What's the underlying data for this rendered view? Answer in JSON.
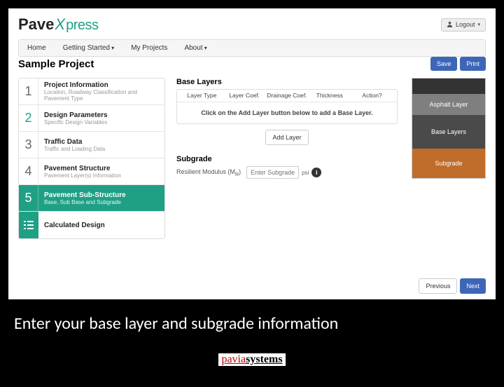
{
  "logo": {
    "a": "Pave",
    "b": "X",
    "c": "press"
  },
  "logout": "Logout",
  "nav": [
    {
      "label": "Home",
      "drop": false
    },
    {
      "label": "Getting Started",
      "drop": true
    },
    {
      "label": "My Projects",
      "drop": false
    },
    {
      "label": "About",
      "drop": true
    }
  ],
  "page_title": "Sample Project",
  "buttons": {
    "save": "Save",
    "print": "Print",
    "previous": "Previous",
    "next": "Next",
    "add_layer": "Add Layer"
  },
  "steps": [
    {
      "n": "1",
      "title": "Project Information",
      "desc": "Location, Roadway Classification and Pavement Type"
    },
    {
      "n": "2",
      "title": "Design Parameters",
      "desc": "Specific Design Variables"
    },
    {
      "n": "3",
      "title": "Traffic Data",
      "desc": "Traffic and Loading Data"
    },
    {
      "n": "4",
      "title": "Pavement Structure",
      "desc": "Pavement Layer(s) Information"
    },
    {
      "n": "5",
      "title": "Pavement Sub-Structure",
      "desc": "Base, Sub Base and Subgrade"
    }
  ],
  "calc": "Calculated Design",
  "base_layers": {
    "title": "Base Layers",
    "columns": [
      "Layer Type",
      "Layer Coef.",
      "Drainage Coef.",
      "Thickness",
      "Action?"
    ],
    "empty": "Click on the Add Layer button below to add a Base Layer."
  },
  "subgrade": {
    "title": "Subgrade",
    "label_a": "Resilient Modulus (M",
    "label_b": "R",
    "label_c": ")",
    "placeholder": "Enter Subgrade",
    "unit": "psi"
  },
  "stack": {
    "asphalt": "Asphalt Layer",
    "base": "Base Layers",
    "sub": "Subgrade"
  },
  "caption": "Enter your base layer and subgrade information",
  "footer": {
    "a": "pavia",
    "b": "systems"
  }
}
